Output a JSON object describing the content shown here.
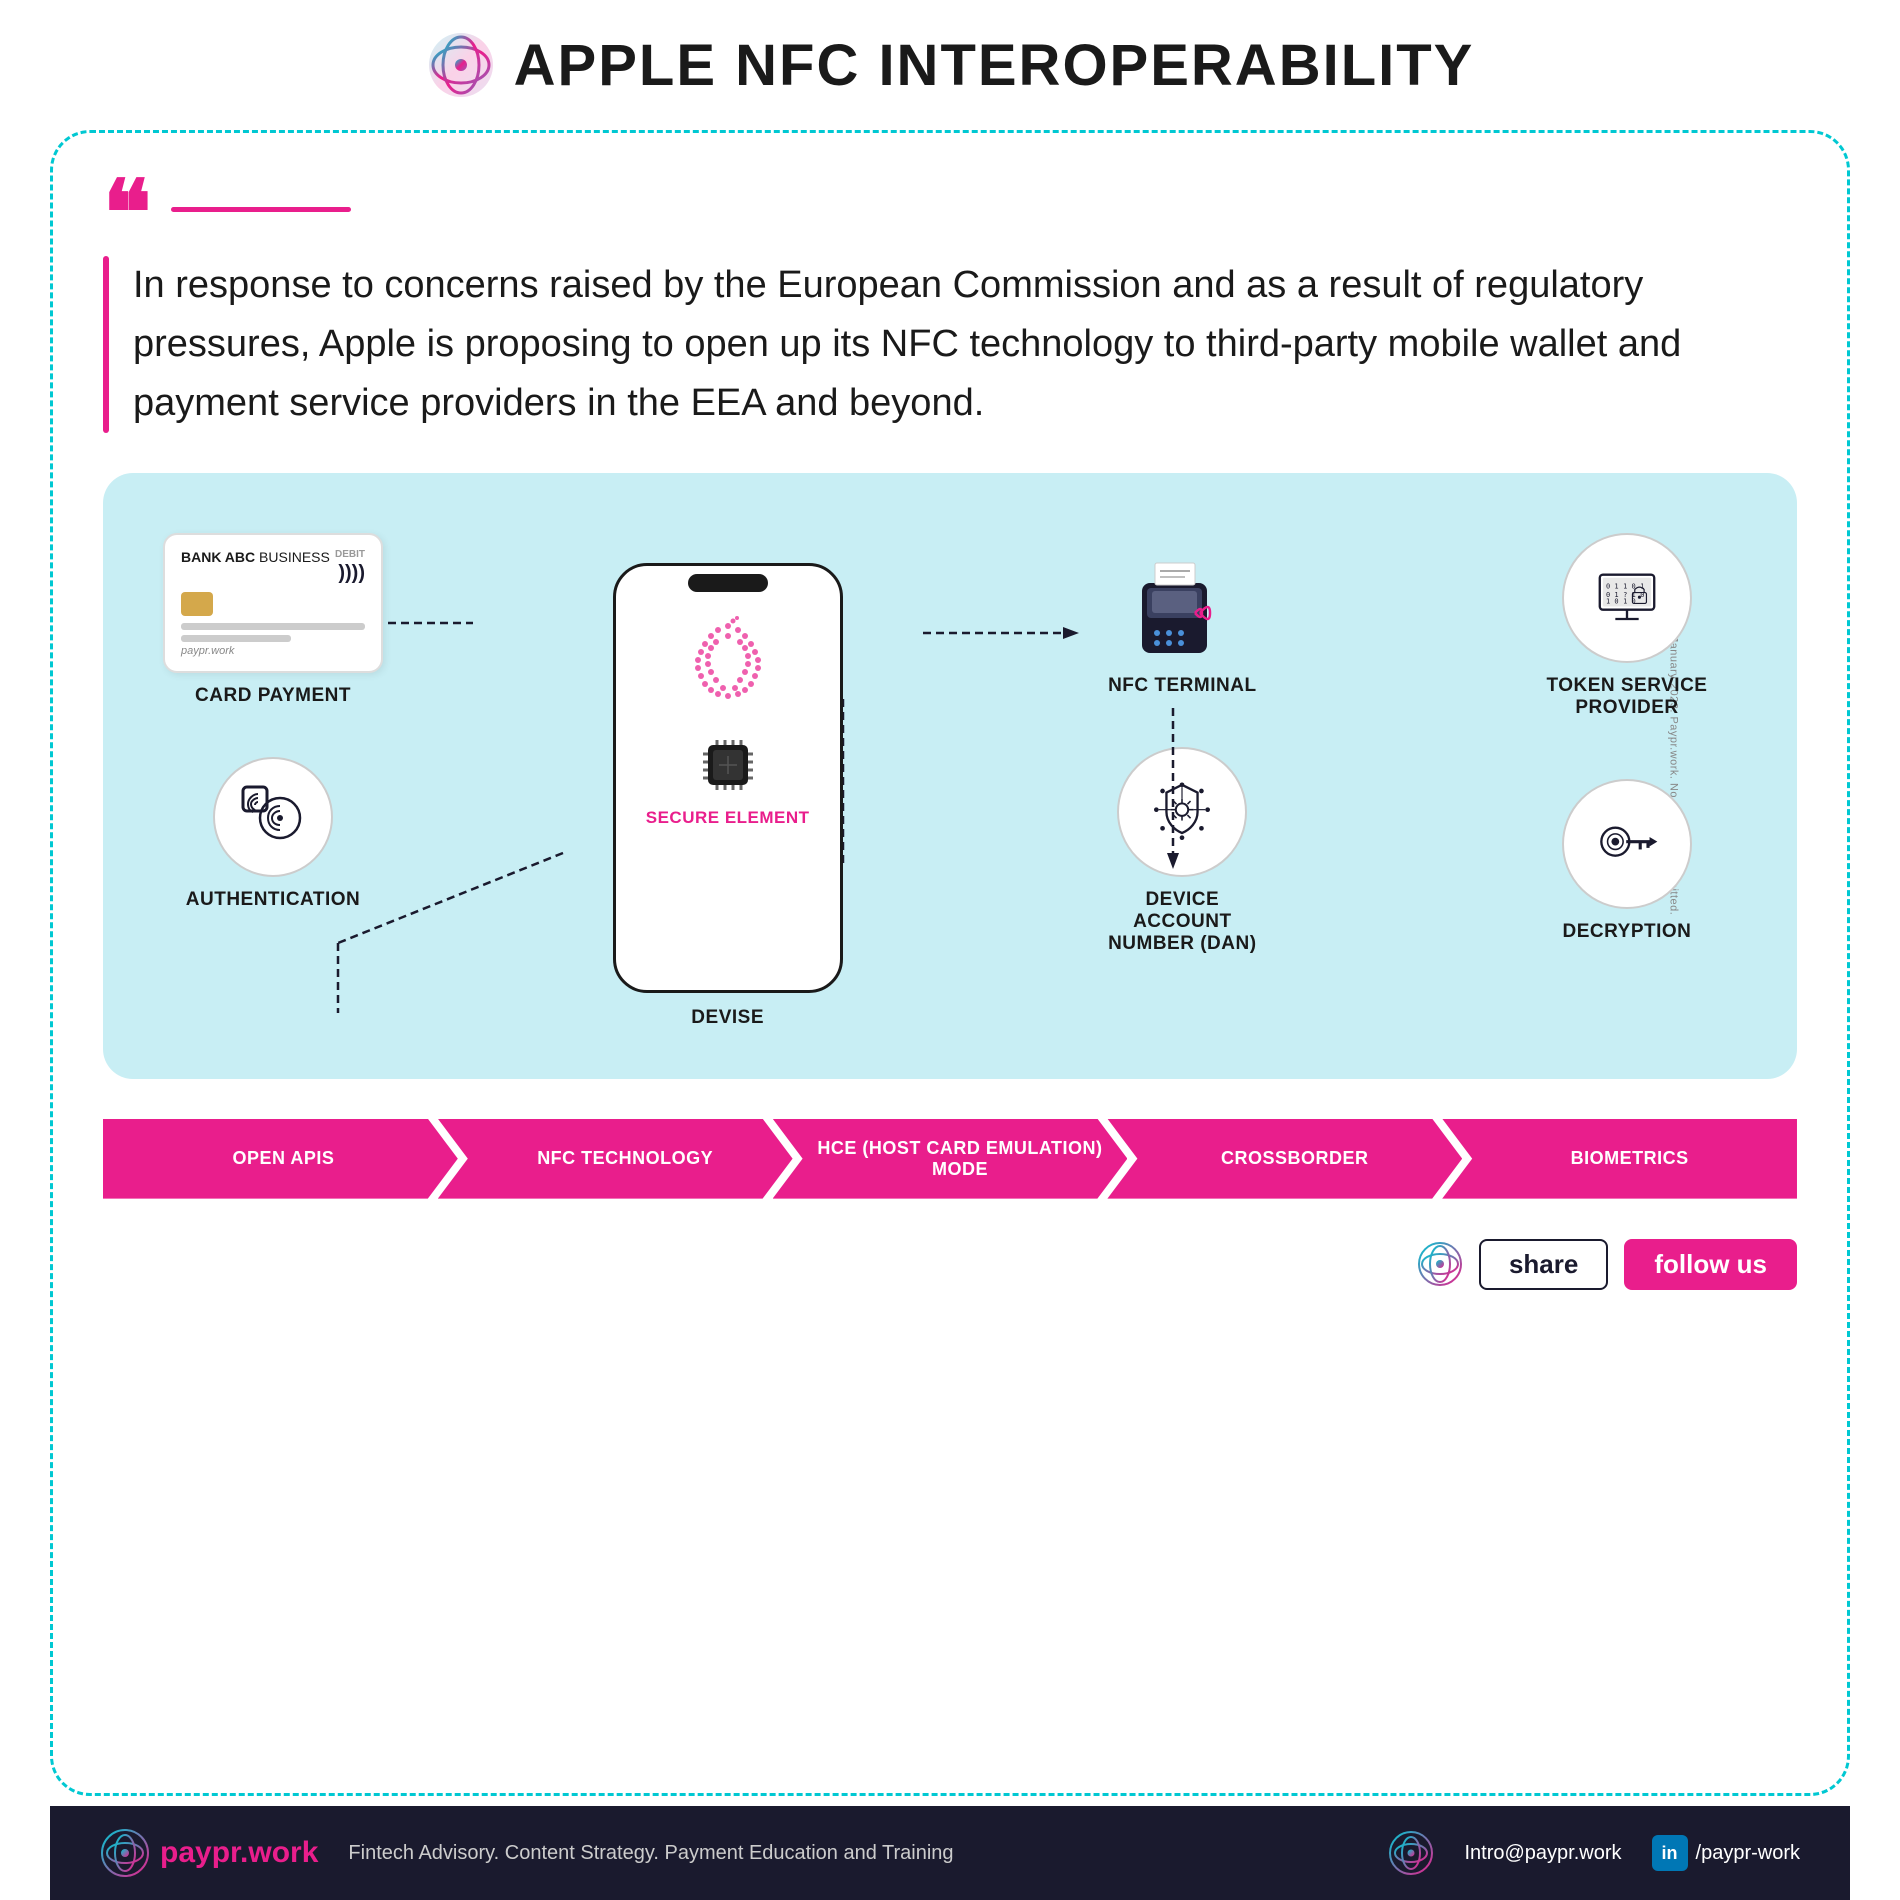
{
  "header": {
    "title": "APPLE NFC INTEROPERABILITY"
  },
  "quote": {
    "text": "In response to concerns raised by  the European Commission and as a result of regulatory pressures, Apple is proposing to open up its NFC technology to third-party mobile wallet and payment service providers in the EEA and beyond."
  },
  "diagram": {
    "card_label": "CARD PAYMENT",
    "card_bank": "BANK ABC",
    "card_type": "BUSINESS",
    "card_debit": "DEBIT",
    "phone_label": "DEVISE",
    "secure_element": "SECURE ELEMENT",
    "authentication_label": "AUTHENTICATION",
    "terminal_label": "NFC TERMINAL",
    "token_label": "TOKEN SERVICE PROVIDER",
    "dan_label": "DEVICE ACCOUNT NUMBER (DAN)",
    "decrypt_label": "DECRYPTION",
    "side_text": "January 2023. Paypr.work. No alterations permitted."
  },
  "arrows": [
    {
      "label": "OPEN APIS",
      "color": "pink"
    },
    {
      "label": "NFC TECHNOLOGY",
      "color": "purple"
    },
    {
      "label": "HCE (HOST CARD EMULATION) MODE",
      "color": "pink"
    },
    {
      "label": "CROSSBORDER",
      "color": "purple"
    },
    {
      "label": "BIOMETRICS",
      "color": "pink"
    }
  ],
  "follow": {
    "share_label": "share",
    "follow_label": "follow us"
  },
  "footer": {
    "logo_part1": "paypr",
    "logo_part2": ".work",
    "tagline": "Fintech Advisory. Content Strategy. Payment Education and  Training",
    "email": "Intro@paypr.work",
    "linkedin": "/paypr-work"
  }
}
